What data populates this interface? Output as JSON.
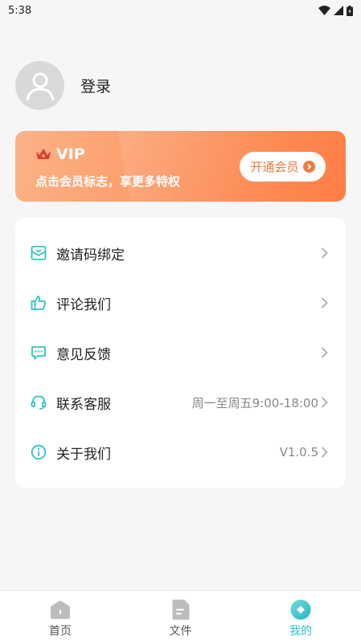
{
  "status_bar": {
    "time": "5:38"
  },
  "profile": {
    "login_label": "登录"
  },
  "vip": {
    "title": "VIP",
    "subtitle": "点击会员标志，享更多特权",
    "button_label": "开通会员"
  },
  "menu": {
    "items": [
      {
        "label": "邀请码绑定",
        "value": "",
        "icon": "invite-code-icon"
      },
      {
        "label": "评论我们",
        "value": "",
        "icon": "thumbs-up-icon"
      },
      {
        "label": "意见反馈",
        "value": "",
        "icon": "feedback-icon"
      },
      {
        "label": "联系客服",
        "value": "周一至周五9:00-18:00",
        "icon": "headset-icon"
      },
      {
        "label": "关于我们",
        "value": "V1.0.5",
        "icon": "info-icon"
      }
    ]
  },
  "nav": {
    "items": [
      {
        "label": "首页",
        "icon": "home-icon"
      },
      {
        "label": "文件",
        "icon": "file-icon"
      },
      {
        "label": "我的",
        "icon": "profile-tab-icon"
      }
    ],
    "active_index": 2
  },
  "colors": {
    "accent": "#2ec4c4",
    "vip_orange": "#f07a3c"
  }
}
